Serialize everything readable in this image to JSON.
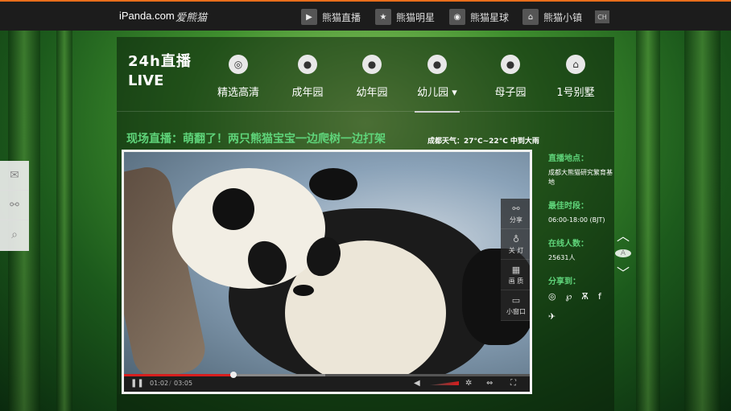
{
  "topbar": {
    "logo": "iPanda.com",
    "logo_cn": "爱熊猫",
    "nav": [
      {
        "icon": "play-icon",
        "label": "熊猫直播"
      },
      {
        "icon": "star-icon",
        "label": "熊猫明星"
      },
      {
        "icon": "globe-icon",
        "label": "熊猫星球"
      },
      {
        "icon": "town-icon",
        "label": "熊猫小镇"
      }
    ],
    "lang": "CH"
  },
  "brand": {
    "line1": "24h直播",
    "line2": "LIVE"
  },
  "nav": [
    {
      "icon": "camera-icon",
      "label": "精选高清"
    },
    {
      "icon": "panda-adult-icon",
      "label": "成年园"
    },
    {
      "icon": "panda-young-icon",
      "label": "幼年园"
    },
    {
      "icon": "panda-kid-icon",
      "label": "幼儿园 ▾",
      "active": true
    },
    {
      "icon": "panda-mother-icon",
      "label": "母子园"
    },
    {
      "icon": "house-icon",
      "label": "1号别墅"
    }
  ],
  "headline": "现场直播：萌翻了！两只熊猫宝宝一边爬树一边打架",
  "weather": "成都天气：27°C~22°C  中到大雨",
  "video": {
    "progress": 0.27,
    "current_time": "01:02",
    "duration": "03:05",
    "tools": [
      {
        "icon": "share-icon",
        "label": "分享"
      },
      {
        "icon": "bulb-icon",
        "label": "关 灯"
      },
      {
        "icon": "quality-icon",
        "label": "画 质"
      },
      {
        "icon": "mini-window-icon",
        "label": "小窗口"
      }
    ]
  },
  "info": {
    "location_label": "直播地点：",
    "location_value": "成都大熊猫研究繁育基地",
    "time_label": "最佳时段：",
    "time_value": "06:00-18:00 (BJT)",
    "online_label": "在线人数：",
    "online_value": "25631人",
    "share_label": "分享到："
  },
  "colors": {
    "accent": "#5fd47a",
    "topbar_border": "#e86d1b",
    "progress": "#d61e1e"
  }
}
